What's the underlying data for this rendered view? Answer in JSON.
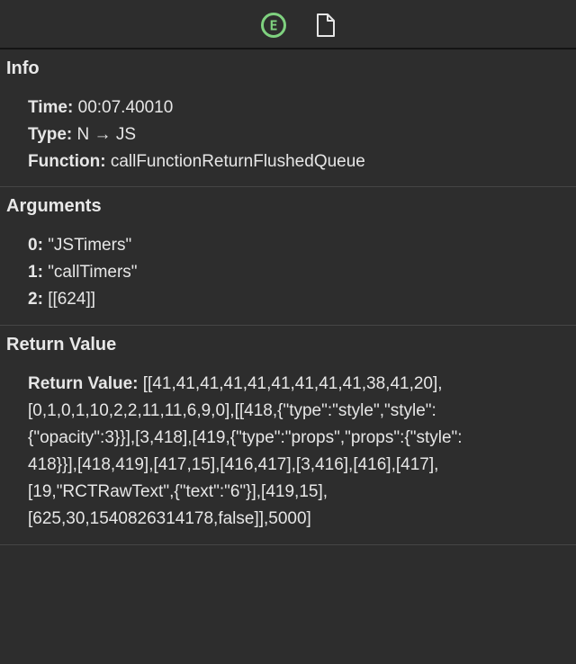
{
  "toolbar": {
    "event_icon_letter": "E",
    "accent_color": "#7fd17f"
  },
  "info": {
    "title": "Info",
    "rows": [
      {
        "key": "Time:",
        "value": "00:07.40010"
      },
      {
        "key": "Type:",
        "value": "N → JS"
      },
      {
        "key": "Function:",
        "value": "callFunctionReturnFlushedQueue"
      }
    ]
  },
  "arguments": {
    "title": "Arguments",
    "rows": [
      {
        "key": "0:",
        "value": "\"JSTimers\""
      },
      {
        "key": "1:",
        "value": "\"callTimers\""
      },
      {
        "key": "2:",
        "value": "[[624]]"
      }
    ]
  },
  "return_value": {
    "title": "Return Value",
    "key": "Return Value:",
    "lines": [
      "[[41,41,41,41,41,41,41,41,41,38,41,20],",
      "[0,1,0,1,10,2,2,11,11,6,9,0],[[418,{\"type\":\"style\",\"style\":",
      "{\"opacity\":3}}],[3,418],[419,{\"type\":\"props\",\"props\":{\"style\":",
      "418}}],[418,419],[417,15],[416,417],[3,416],[416],[417],",
      "[19,\"RCTRawText\",{\"text\":\"6\"}],[419,15],",
      "[625,30,1540826314178,false]],5000]"
    ]
  }
}
